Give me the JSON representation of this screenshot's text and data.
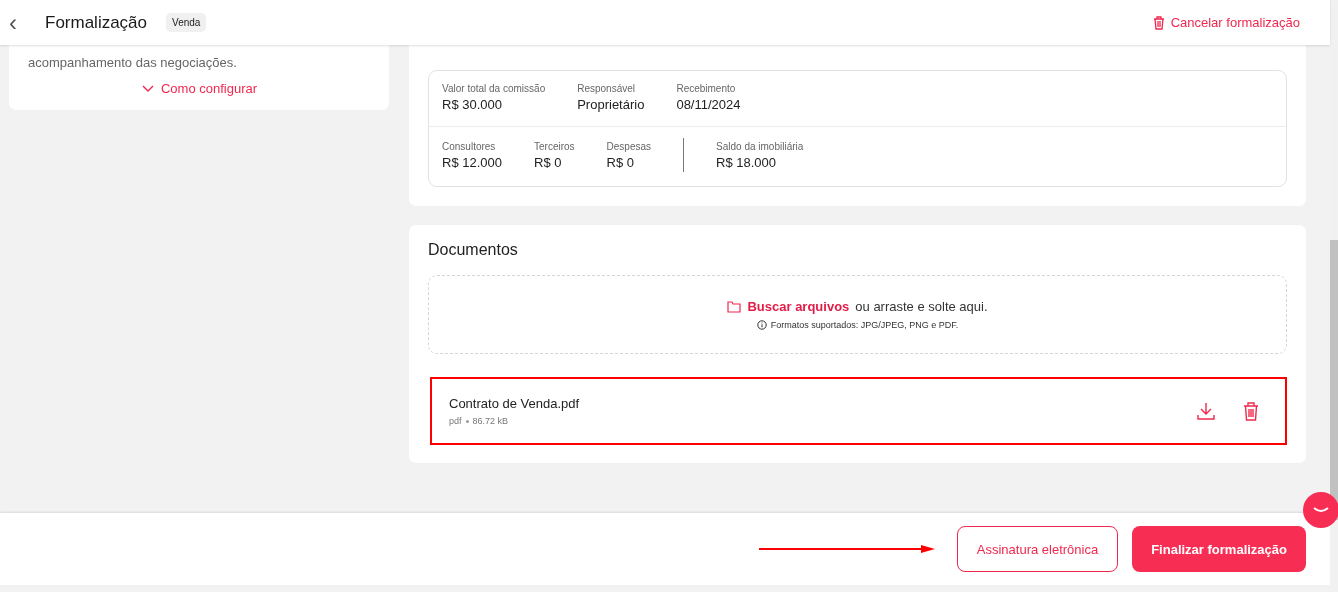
{
  "header": {
    "back_icon": "‹",
    "title": "Formalização",
    "badge": "Venda",
    "cancel_label": "Cancelar formalização"
  },
  "info_card": {
    "text": "acompanhamento das negociações.",
    "link": "Como configurar"
  },
  "commission": {
    "row_1": [
      {
        "label": "Valor total da comissão",
        "value": "R$ 30.000"
      },
      {
        "label": "Responsável",
        "value": "Proprietário"
      },
      {
        "label": "Recebimento",
        "value": "08/11/2024"
      }
    ],
    "row_2": [
      {
        "label": "Consultores",
        "value": "R$ 12.000"
      },
      {
        "label": "Terceiros",
        "value": "R$ 0"
      },
      {
        "label": "Despesas",
        "value": "R$ 0"
      }
    ],
    "balance": {
      "label": "Saldo da imobiliária",
      "value": "R$ 18.000"
    }
  },
  "documents": {
    "title": "Documentos",
    "dropzone": {
      "link": "Buscar arquivos",
      "text": "ou arraste e solte aqui.",
      "formats": "Formatos suportados:  JPG/JPEG, PNG e PDF."
    },
    "files": [
      {
        "name": "Contrato de Venda.pdf",
        "type": "pdf",
        "size": "86.72 kB",
        "highlighted": true
      }
    ]
  },
  "footer": {
    "buttons": [
      {
        "label": "Assinatura eletrônica",
        "kind": "outline"
      },
      {
        "label": "Finalizar formalização",
        "kind": "primary"
      }
    ]
  }
}
